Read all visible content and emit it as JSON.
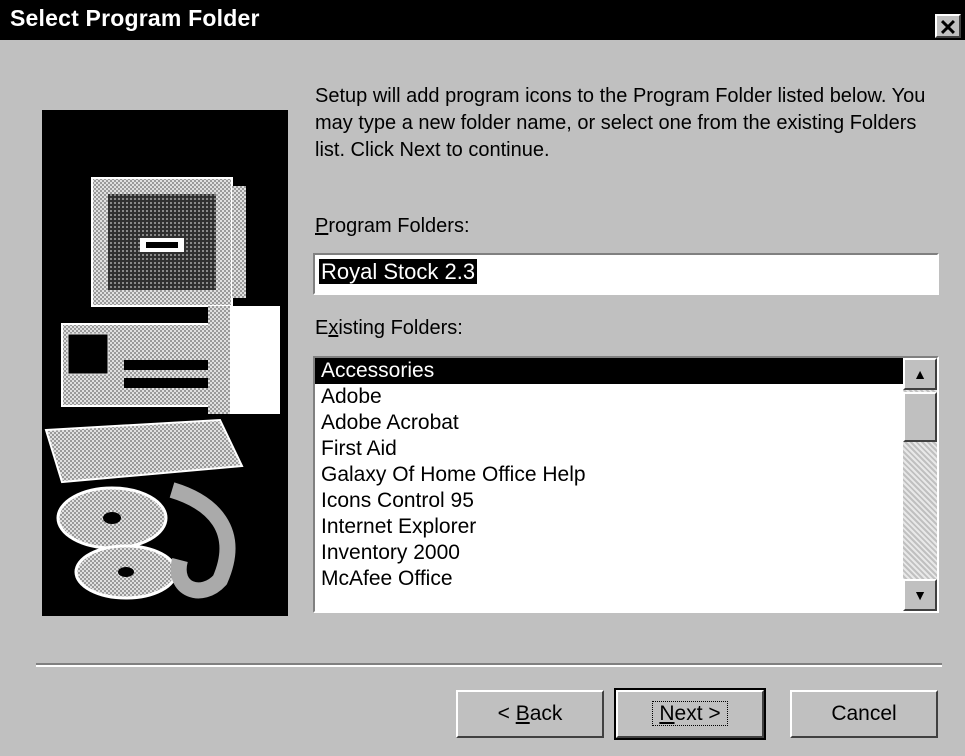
{
  "window": {
    "title": "Select Program Folder",
    "close_glyph": "✕"
  },
  "intro_text": "Setup will add program icons to the Program Folder listed below. You may type a new folder name, or select one from the existing Folders list. Click Next to continue.",
  "program_folders": {
    "label_accel": "P",
    "label_rest": "rogram Folders:",
    "value": "Royal Stock 2.3"
  },
  "existing_folders": {
    "label_accel": "x",
    "label_pre": "E",
    "label_rest": "isting Folders:",
    "items": [
      "Accessories",
      "Adobe",
      "Adobe Acrobat",
      "First Aid",
      "Galaxy Of Home Office Help",
      "Icons Control 95",
      "Internet Explorer",
      "Inventory 2000",
      "McAfee Office"
    ],
    "selected_index": 0
  },
  "buttons": {
    "back_pre": "< ",
    "back_accel": "B",
    "back_rest": "ack",
    "next_accel": "N",
    "next_rest": "ext >",
    "cancel": "Cancel"
  },
  "icons": {
    "close": "close-icon",
    "scroll_up": "up-arrow-icon",
    "scroll_down": "down-arrow-icon",
    "illustration": "computer-with-cds-illustration"
  }
}
